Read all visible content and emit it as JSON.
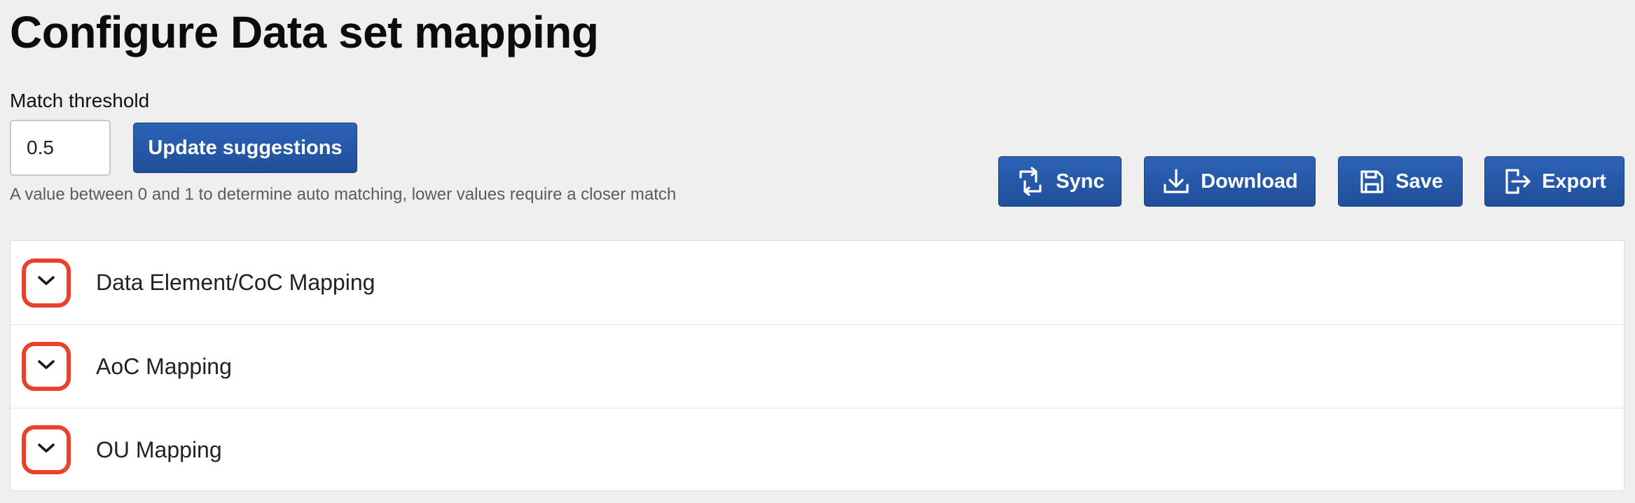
{
  "page": {
    "title": "Configure Data set mapping"
  },
  "threshold": {
    "label": "Match threshold",
    "value": "0.5",
    "help": "A value between 0 and 1 to determine auto matching, lower values require a closer match",
    "update_button": "Update suggestions"
  },
  "toolbar": {
    "sync": {
      "label": "Sync",
      "icon": "sync-icon"
    },
    "download": {
      "label": "Download",
      "icon": "download-icon"
    },
    "save": {
      "label": "Save",
      "icon": "save-icon"
    },
    "export": {
      "label": "Export",
      "icon": "export-icon"
    }
  },
  "accordion": {
    "items": [
      {
        "label": "Data Element/CoC Mapping",
        "icon": "chevron-down-icon"
      },
      {
        "label": "AoC Mapping",
        "icon": "chevron-down-icon"
      },
      {
        "label": "OU Mapping",
        "icon": "chevron-down-icon"
      }
    ]
  },
  "colors": {
    "primary_button": "#2557a7",
    "highlight_outline": "#e8412c",
    "background": "#efefef"
  }
}
